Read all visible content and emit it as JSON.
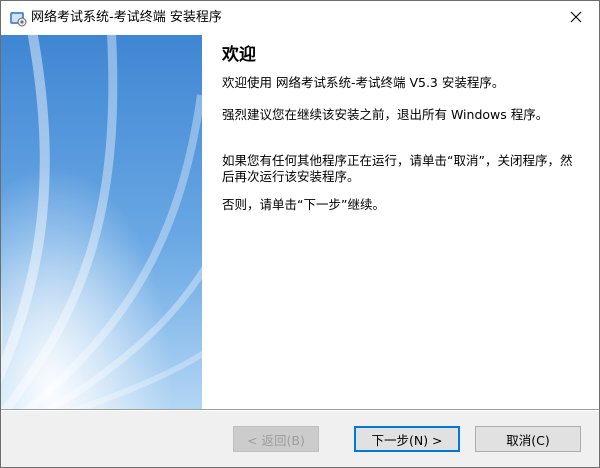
{
  "window": {
    "title": "网络考试系统-考试终端 安装程序",
    "icon": "installer-icon",
    "close_icon": "close-icon"
  },
  "welcome": {
    "heading": "欢迎",
    "para1": "欢迎使用 网络考试系统-考试终端 V5.3 安装程序。",
    "para2": "强烈建议您在继续该安装之前，退出所有 Windows 程序。",
    "para3": "如果您有任何其他程序正在运行，请单击“取消”，关闭程序，然后再次运行该安装程序。",
    "para4": "否则，请单击“下一步”继续。"
  },
  "buttons": {
    "back_label": "< 返回(B)",
    "next_label": "下一步(N) >",
    "cancel_label": "取消(C)"
  },
  "colors": {
    "banner_top": "#4b8fd6",
    "banner_bottom": "#a9d0f2",
    "accent": "#0078d7"
  }
}
